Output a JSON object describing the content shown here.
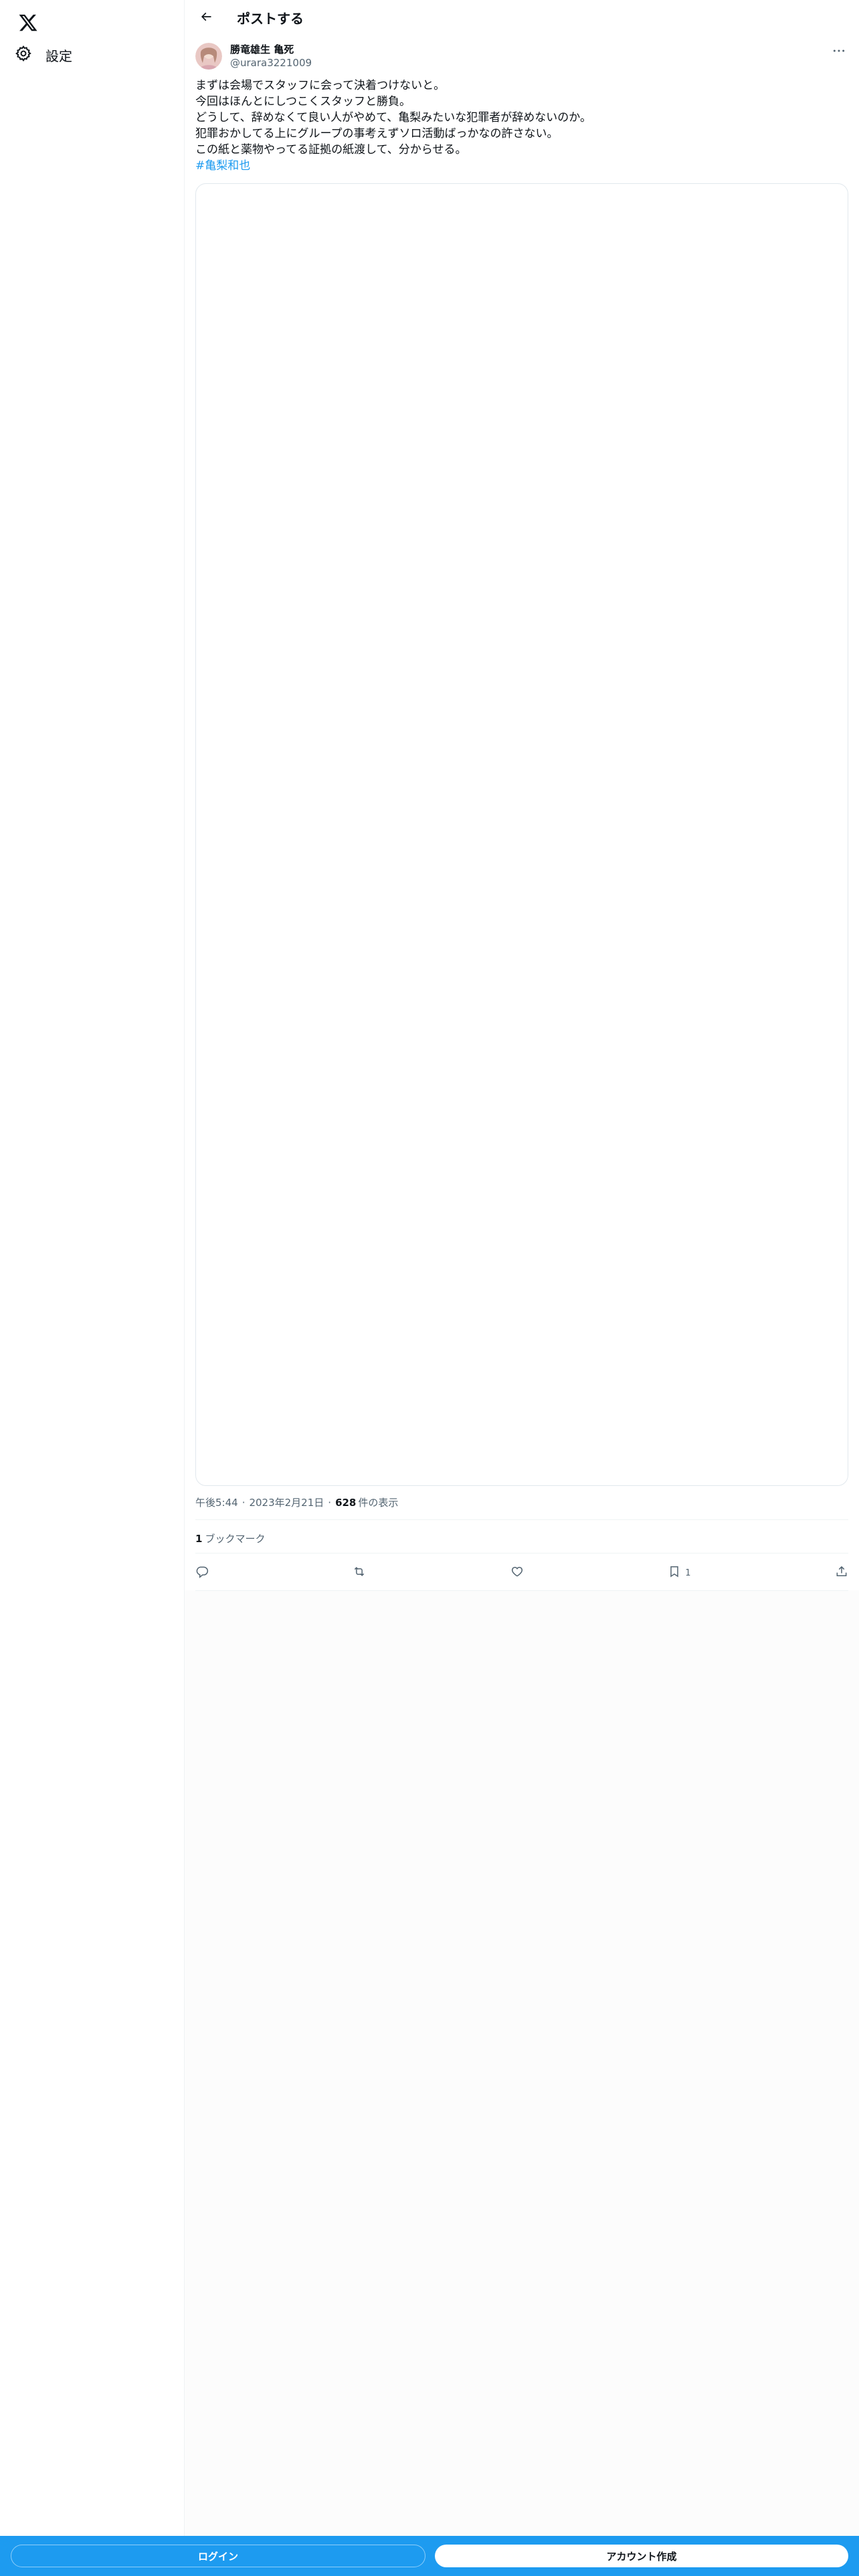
{
  "nav": {
    "logo_icon": "x-logo-icon",
    "settings_icon": "gear-icon",
    "settings_label": "設定"
  },
  "header": {
    "back_icon": "arrow-left-icon",
    "title": "ポストする"
  },
  "post": {
    "author": {
      "display_name": "勝竜雄生 亀死",
      "handle": "@urara3221009"
    },
    "more_icon": "more-dots-icon",
    "text_lines": [
      "まずは会場でスタッフに会って決着つけないと。",
      "今回はほんとにしつこくスタッフと勝負。",
      "どうして、辞めなくて良い人がやめて、亀梨みたいな犯罪者が辞めないのか。",
      "犯罪おかしてる上にグループの事考えずソロ活動ばっかなの許さない。",
      "この紙と薬物やってる証拠の紙渡して、分からせる。"
    ],
    "hashtag": "#亀梨和也",
    "time": "午後5:44",
    "date": "2023年2月21日",
    "views_count": "628",
    "views_label": "件の表示",
    "bookmark_count": "1",
    "bookmark_label": "ブックマーク",
    "actions": {
      "reply_icon": "reply-icon",
      "repost_icon": "repost-icon",
      "like_icon": "heart-icon",
      "bookmark_icon": "bookmark-icon",
      "bookmark_count": "1",
      "share_icon": "share-icon"
    }
  },
  "bottom_bar": {
    "login_label": "ログイン",
    "signup_label": "アカウント作成"
  },
  "colors": {
    "accent": "#1d9bf0",
    "text": "#0f1419",
    "secondary_text": "#536471"
  }
}
